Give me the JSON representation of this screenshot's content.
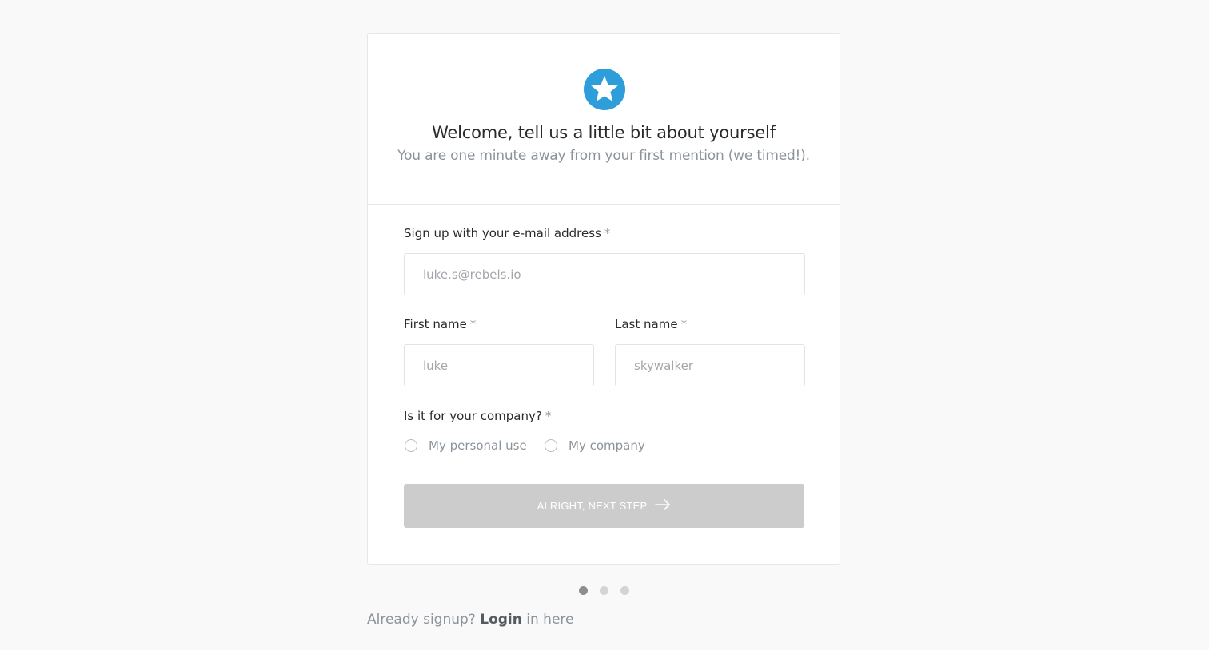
{
  "header": {
    "title": "Welcome, tell us a little bit about yourself",
    "subtitle": "You are one minute away from your first mention (we timed!).",
    "logo_icon": "star-icon",
    "accent_color": "#2e9edb"
  },
  "form": {
    "email": {
      "label": "Sign up with your e-mail address",
      "required_mark": "*",
      "placeholder": "luke.s@rebels.io",
      "value": ""
    },
    "first_name": {
      "label": "First name",
      "required_mark": "*",
      "placeholder": "luke",
      "value": ""
    },
    "last_name": {
      "label": "Last name",
      "required_mark": "*",
      "placeholder": "skywalker",
      "value": ""
    },
    "company": {
      "label": "Is it for your company?",
      "required_mark": "*",
      "options": [
        {
          "label": "My personal use",
          "selected": false
        },
        {
          "label": "My company",
          "selected": false
        }
      ]
    },
    "submit": {
      "label": "ALRIGHT, NEXT STEP",
      "icon": "arrow-right-icon",
      "enabled": false
    }
  },
  "pagination": {
    "total_steps": 3,
    "current_step": 1
  },
  "footer": {
    "prefix": "Already signup?",
    "login_label": "Login",
    "suffix": "in here"
  }
}
